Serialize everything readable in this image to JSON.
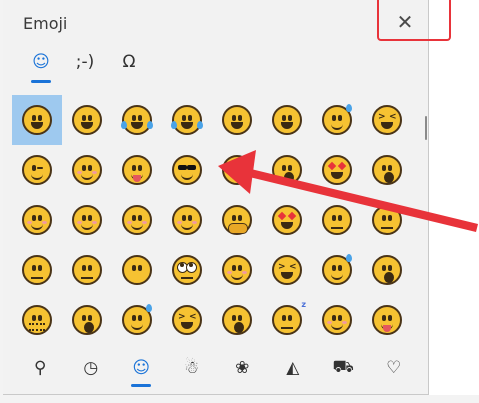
{
  "window": {
    "title": "Emoji",
    "close_glyph": "✕"
  },
  "tabs": [
    {
      "label": "☺",
      "icon": "smiley-icon",
      "active": true
    },
    {
      "label": ";-)",
      "icon": "kaomoji-icon",
      "active": false
    },
    {
      "label": "Ω",
      "icon": "omega-symbols-icon",
      "active": false
    }
  ],
  "emoji_grid": {
    "selected_index": 0,
    "items": [
      {
        "name": "grinning-face",
        "style": "open"
      },
      {
        "name": "beaming-face",
        "style": "open"
      },
      {
        "name": "joy-face",
        "style": "joy"
      },
      {
        "name": "rofl-face",
        "style": "joy-tilt"
      },
      {
        "name": "smiling-face",
        "style": "open"
      },
      {
        "name": "grinning-smiling-eyes",
        "style": "open"
      },
      {
        "name": "sweat-smile-face",
        "style": "sweat"
      },
      {
        "name": "squinting-face",
        "style": "xeyes"
      },
      {
        "name": "winking-face",
        "style": "wink"
      },
      {
        "name": "smiling-eyes-face",
        "style": "smile"
      },
      {
        "name": "yum-face",
        "style": "tongue"
      },
      {
        "name": "sunglasses-face",
        "style": "shades"
      },
      {
        "name": "heart-eyes-face",
        "style": "hearts"
      },
      {
        "name": "kissing-face",
        "style": "oh"
      },
      {
        "name": "smiling-hearts-face",
        "style": "hearts"
      },
      {
        "name": "hushed-face",
        "style": "oh"
      },
      {
        "name": "blushing-face",
        "style": "smile"
      },
      {
        "name": "hugging-face",
        "style": "smile"
      },
      {
        "name": "relaxed-face",
        "style": "smile"
      },
      {
        "name": "slight-smile-face",
        "style": "smile"
      },
      {
        "name": "hug-face",
        "style": "hand"
      },
      {
        "name": "star-struck-face",
        "style": "hearts"
      },
      {
        "name": "thinking-face",
        "style": "flat"
      },
      {
        "name": "monocle-face",
        "style": "flat"
      },
      {
        "name": "neutral-face",
        "style": "flat"
      },
      {
        "name": "expressionless-face",
        "style": "flat"
      },
      {
        "name": "no-mouth-face",
        "style": "nomouth"
      },
      {
        "name": "rolling-eyes-face",
        "style": "rolleyes"
      },
      {
        "name": "smirk-face",
        "style": "smile"
      },
      {
        "name": "persevering-face",
        "style": "xeyes"
      },
      {
        "name": "sad-relieved-face",
        "style": "sweat"
      },
      {
        "name": "astonished-face",
        "style": "oh"
      },
      {
        "name": "zipper-face",
        "style": "zip"
      },
      {
        "name": "hushed-face-2",
        "style": "oh"
      },
      {
        "name": "sleepy-face",
        "style": "sweat"
      },
      {
        "name": "tired-face",
        "style": "xeyes"
      },
      {
        "name": "yawning-face",
        "style": "oh"
      },
      {
        "name": "sleeping-face",
        "style": "zzz"
      },
      {
        "name": "relieved-face",
        "style": "smile"
      },
      {
        "name": "tongue-face",
        "style": "tongue"
      }
    ]
  },
  "bottom_tabs": [
    {
      "label": "⚲",
      "icon": "search-icon",
      "active": false
    },
    {
      "label": "◷",
      "icon": "recent-clock-icon",
      "active": false
    },
    {
      "label": "☺",
      "icon": "smiley-faces-icon",
      "active": true
    },
    {
      "label": "☃",
      "icon": "people-icon",
      "active": false
    },
    {
      "label": "❀",
      "icon": "nature-icon",
      "active": false
    },
    {
      "label": "◭",
      "icon": "food-pizza-icon",
      "active": false
    },
    {
      "label": "⛟",
      "icon": "travel-car-icon",
      "active": false
    },
    {
      "label": "♡",
      "icon": "heart-symbols-icon",
      "active": false
    }
  ],
  "colors": {
    "accent": "#1a73d8",
    "selection": "#9ec9ef",
    "annotation": "#e8333a",
    "emoji_yellow": "#f6c232"
  }
}
